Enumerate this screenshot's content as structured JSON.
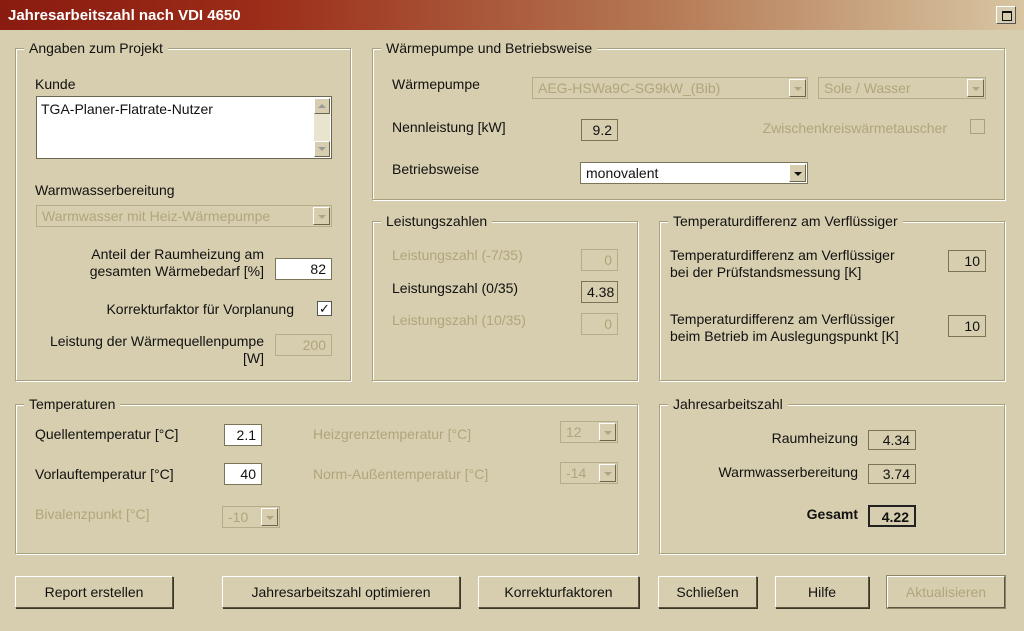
{
  "window": {
    "title": "Jahresarbeitszahl nach VDI 4650"
  },
  "projekt": {
    "legend": "Angaben zum Projekt",
    "kunde_label": "Kunde",
    "kunde_value": "TGA-Planer-Flatrate-Nutzer",
    "warmwasser_label": "Warmwasserbereitung",
    "warmwasser_value": "Warmwasser mit Heiz-Wärmepumpe",
    "anteil_label_1": "Anteil der Raumheizung am",
    "anteil_label_2": "gesamten Wärmebedarf [%]",
    "anteil_value": "82",
    "korrektur_label": "Korrekturfaktor für Vorplanung",
    "korrektur_checked": true,
    "korrektur_mark": "✓",
    "pumpe_label_1": "Leistung der Wärmequellenpumpe",
    "pumpe_label_2": "[W]",
    "pumpe_value": "200"
  },
  "waermepumpe": {
    "legend": "Wärmepumpe und Betriebsweise",
    "wp_label": "Wärmepumpe",
    "wp_value": "AEG-HSWa9C-SG9kW_(Bib)",
    "art_value": "Sole / Wasser",
    "nenn_label": "Nennleistung [kW]",
    "nenn_value": "9.2",
    "zwischen_label": "Zwischenkreiswärmetauscher",
    "betrieb_label": "Betriebsweise",
    "betrieb_value": "monovalent"
  },
  "leistungszahlen": {
    "legend": "Leistungszahlen",
    "items": [
      {
        "label": "Leistungszahl (-7/35)",
        "value": "0"
      },
      {
        "label": "Leistungszahl (0/35)",
        "value": "4.38"
      },
      {
        "label": "Leistungszahl (10/35)",
        "value": "0"
      }
    ]
  },
  "tempdiff": {
    "legend": "Temperaturdifferenz am Verflüssiger",
    "pruef_label_1": "Temperaturdifferenz am Verflüssiger",
    "pruef_label_2": "bei der Prüfstandsmessung [K]",
    "pruef_value": "10",
    "betrieb_label_1": "Temperaturdifferenz am Verflüssiger",
    "betrieb_label_2": "beim Betrieb im Auslegungspunkt [K]",
    "betrieb_value": "10"
  },
  "temperaturen": {
    "legend": "Temperaturen",
    "quelle_label": "Quellentemperatur [°C]",
    "quelle_value": "2.1",
    "vorlauf_label": "Vorlauftemperatur [°C]",
    "vorlauf_value": "40",
    "bivalenz_label": "Bivalenzpunkt [°C]",
    "bivalenz_value": "-10",
    "heizgrenz_label": "Heizgrenztemperatur [°C]",
    "heizgrenz_value": "12",
    "norm_label": "Norm-Außentemperatur [°C]",
    "norm_value": "-14"
  },
  "jaz": {
    "legend": "Jahresarbeitszahl",
    "raum_label": "Raumheizung",
    "raum_value": "4.34",
    "ww_label": "Warmwasserbereitung",
    "ww_value": "3.74",
    "gesamt_label": "Gesamt",
    "gesamt_value": "4.22"
  },
  "buttons": {
    "report": "Report erstellen",
    "optimieren": "Jahresarbeitszahl optimieren",
    "korrektur": "Korrekturfaktoren",
    "schliessen": "Schließen",
    "hilfe": "Hilfe",
    "aktualisieren": "Aktualisieren"
  }
}
